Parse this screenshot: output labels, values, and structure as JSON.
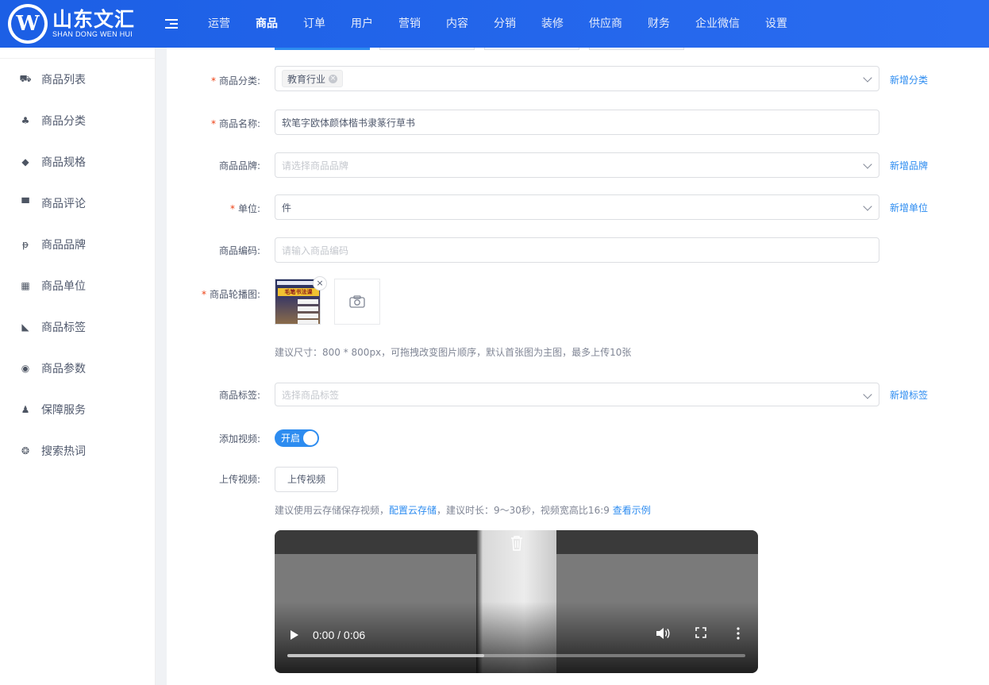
{
  "brand": {
    "logo_letter": "W",
    "name_cn": "山东文汇",
    "name_en": "SHAN DONG WEN HUI"
  },
  "nav": [
    {
      "label": "运营"
    },
    {
      "label": "商品"
    },
    {
      "label": "订单"
    },
    {
      "label": "用户"
    },
    {
      "label": "营销"
    },
    {
      "label": "内容"
    },
    {
      "label": "分销"
    },
    {
      "label": "装修"
    },
    {
      "label": "供应商"
    },
    {
      "label": "财务"
    },
    {
      "label": "企业微信"
    },
    {
      "label": "设置"
    }
  ],
  "nav_active": "商品",
  "sidebar": [
    {
      "label": "商品列表",
      "icon": "basket-icon",
      "glyph": "⛟"
    },
    {
      "label": "商品分类",
      "icon": "category-icon",
      "glyph": "♣"
    },
    {
      "label": "商品规格",
      "icon": "cube-icon",
      "glyph": "◆"
    },
    {
      "label": "商品评论",
      "icon": "comment-icon",
      "glyph": "▀"
    },
    {
      "label": "商品品牌",
      "icon": "brand-icon",
      "glyph": "ᵽ"
    },
    {
      "label": "商品单位",
      "icon": "grid-icon",
      "glyph": "▦"
    },
    {
      "label": "商品标签",
      "icon": "tag-icon",
      "glyph": "◣"
    },
    {
      "label": "商品参数",
      "icon": "eye-icon",
      "glyph": "◉"
    },
    {
      "label": "保障服务",
      "icon": "person-icon",
      "glyph": "♟"
    },
    {
      "label": "搜索热词",
      "icon": "basketball-icon",
      "glyph": "❂"
    }
  ],
  "form": {
    "category": {
      "label": "商品分类:",
      "required": "*",
      "tag": "教育行业",
      "tag_close": "×",
      "link": "新增分类"
    },
    "name": {
      "label": "商品名称:",
      "required": "*",
      "value": "软笔字欧体颜体楷书隶篆行草书"
    },
    "brand": {
      "label": "商品品牌:",
      "placeholder": "请选择商品品牌",
      "link": "新增品牌"
    },
    "unit": {
      "label": "单位:",
      "required": "*",
      "value": "件",
      "link": "新增单位"
    },
    "code": {
      "label": "商品编码:",
      "placeholder": "请输入商品编码"
    },
    "carousel": {
      "label": "商品轮播图:",
      "required": "*",
      "remove": "×",
      "thumb_title": "毛笔书法课",
      "hint": "建议尺寸：800 * 800px，可拖拽改变图片顺序，默认首张图为主图，最多上传10张"
    },
    "tags": {
      "label": "商品标签:",
      "placeholder": "选择商品标签",
      "link": "新增标签"
    },
    "add_video": {
      "label": "添加视频:",
      "switch_text": "开启",
      "on": true
    },
    "upload_video": {
      "label": "上传视频:",
      "button": "上传视频",
      "hint_prefix": "建议使用云存储保存视频，",
      "hint_link1": "配置云存储",
      "hint_middle": "，建议时长：9～30秒，视频宽高比16:9 ",
      "hint_link2": "查看示例"
    },
    "video_player": {
      "time": "0:00 / 0:06",
      "progress": 0.43
    }
  }
}
